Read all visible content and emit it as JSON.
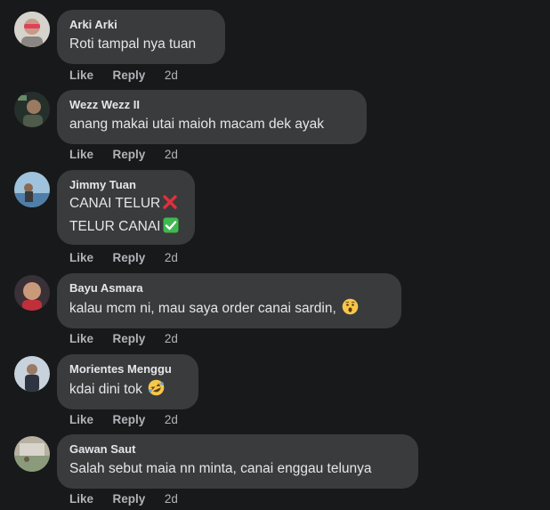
{
  "comments": [
    {
      "name": "Arki Arki",
      "lines": [
        "Roti tampal nya tuan"
      ],
      "like": "Like",
      "reply": "Reply",
      "time": "2d"
    },
    {
      "name": "Wezz Wezz II",
      "lines": [
        "anang makai utai maioh macam dek ayak"
      ],
      "like": "Like",
      "reply": "Reply",
      "time": "2d"
    },
    {
      "name": "Jimmy Tuan",
      "lines": [
        "CANAI TELUR",
        "TELUR CANAI"
      ],
      "like": "Like",
      "reply": "Reply",
      "time": "2d"
    },
    {
      "name": "Bayu Asmara",
      "lines": [
        "kalau mcm ni, mau saya order canai sardin,"
      ],
      "like": "Like",
      "reply": "Reply",
      "time": "2d"
    },
    {
      "name": "Morientes Menggu",
      "lines": [
        "kdai dini tok"
      ],
      "like": "Like",
      "reply": "Reply",
      "time": "2d"
    },
    {
      "name": "Gawan Saut",
      "lines": [
        "Salah sebut maia nn minta, canai enggau telunya"
      ],
      "like": "Like",
      "reply": "Reply",
      "time": "2d"
    }
  ],
  "icons": {
    "jimmy_line1": "cross-mark-icon",
    "jimmy_line2": "check-mark-icon",
    "bayu": "hushed-face-icon",
    "morientes": "rolling-laughing-icon"
  },
  "colors": {
    "background": "#18191a",
    "bubble": "#3a3b3c",
    "text": "#e4e6eb",
    "secondary": "#b0b3b8",
    "cross": "#e0303a",
    "check": "#3fb950"
  }
}
